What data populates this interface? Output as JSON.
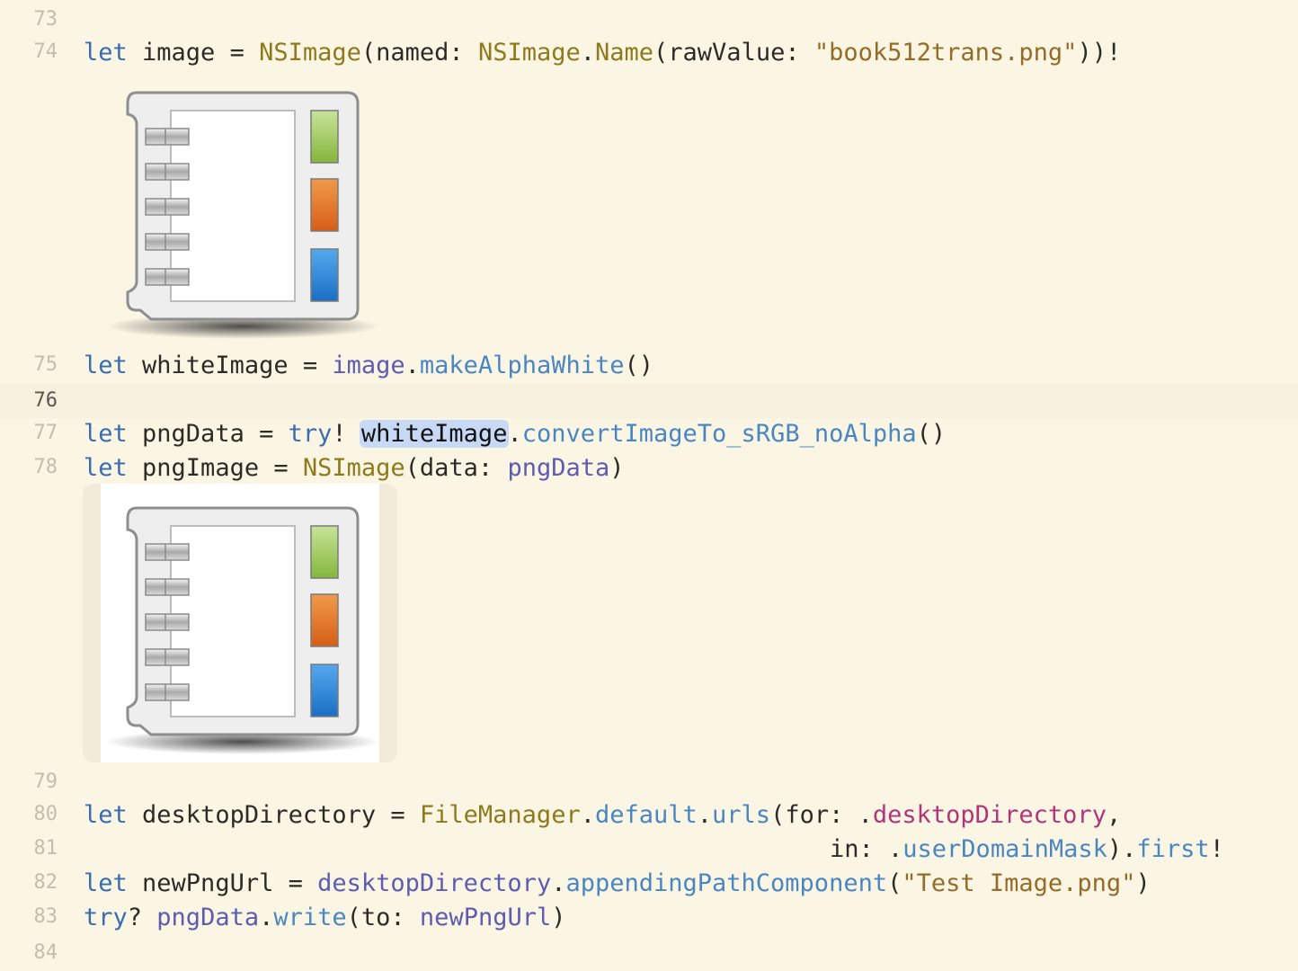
{
  "editor": {
    "lines": [
      {
        "num": "73"
      },
      {
        "num": "74",
        "p1": "let",
        "p2": " image = ",
        "p3": "NSImage",
        "p4": "(named: ",
        "p5": "NSImage",
        "p6": ".",
        "p7": "Name",
        "p8": "(rawValue: ",
        "p9": "\"book512trans.png\"",
        "p10": "))!"
      },
      {
        "num": "75",
        "p1": "let",
        "p2": " whiteImage = ",
        "p3": "image",
        "p4": ".",
        "p5": "makeAlphaWhite",
        "p6": "()"
      },
      {
        "num": "76"
      },
      {
        "num": "77",
        "p1": "let",
        "p2": " pngData = ",
        "p3": "try",
        "p4": "! ",
        "p5": "whiteImage",
        "p6": ".",
        "p7": "convertImageTo_sRGB_noAlpha",
        "p8": "()"
      },
      {
        "num": "78",
        "p1": "let",
        "p2": " pngImage = ",
        "p3": "NSImage",
        "p4": "(data: ",
        "p5": "pngData",
        "p6": ")"
      },
      {
        "num": "79"
      },
      {
        "num": "80",
        "p1": "let",
        "p2": " desktopDirectory = ",
        "p3": "FileManager",
        "p4": ".",
        "p5": "default",
        "p6": ".",
        "p7": "urls",
        "p8": "(for: .",
        "p9": "desktopDirectory",
        "p10": ","
      },
      {
        "num": "81",
        "p1": "in: .",
        "p2": "userDomainMask",
        "p3": ").",
        "p4": "first",
        "p5": "!"
      },
      {
        "num": "82",
        "p1": "let",
        "p2": " newPngUrl = ",
        "p3": "desktopDirectory",
        "p4": ".",
        "p5": "appendingPathComponent",
        "p6": "(",
        "p7": "\"Test Image.png\"",
        "p8": ")"
      },
      {
        "num": "83",
        "p1": "try",
        "p2": "? ",
        "p3": "pngData",
        "p4": ".",
        "p5": "write",
        "p6": "(to: ",
        "p7": "newPngUrl",
        "p8": ")"
      },
      {
        "num": "84"
      }
    ]
  },
  "previews": [
    {
      "icon": "notebook-icon",
      "background": "transparent"
    },
    {
      "icon": "notebook-icon",
      "background": "#ffffff"
    }
  ],
  "colors": {
    "editor_background": "#fbf5e4",
    "keyword": "#3a6cb0",
    "type": "#8e7a1d",
    "function": "#4a86c2",
    "variable": "#5d5cb0",
    "enum_case": "#b0357a",
    "string": "#946c27",
    "selection": "#c8d9f5",
    "tab_green": "#9cc95a",
    "tab_orange": "#e27a2a",
    "tab_blue": "#2e86d6"
  }
}
